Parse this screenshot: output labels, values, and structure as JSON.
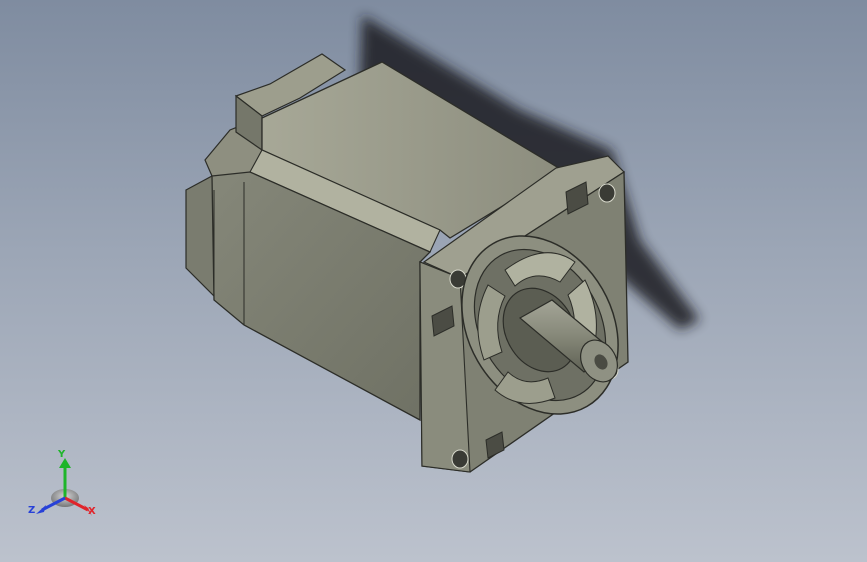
{
  "viewport": {
    "background_top": "#7f8ca0",
    "background_bottom": "#bcc2cd"
  },
  "model": {
    "body_color": "#7f8173",
    "highlight_color": "#a9aa99",
    "shadow_color": "#1b1c20"
  },
  "triad": {
    "x_label": "X",
    "y_label": "Y",
    "z_label": "Z",
    "x_color": "#e0242b",
    "y_color": "#1eb52a",
    "z_color": "#2741d8"
  }
}
